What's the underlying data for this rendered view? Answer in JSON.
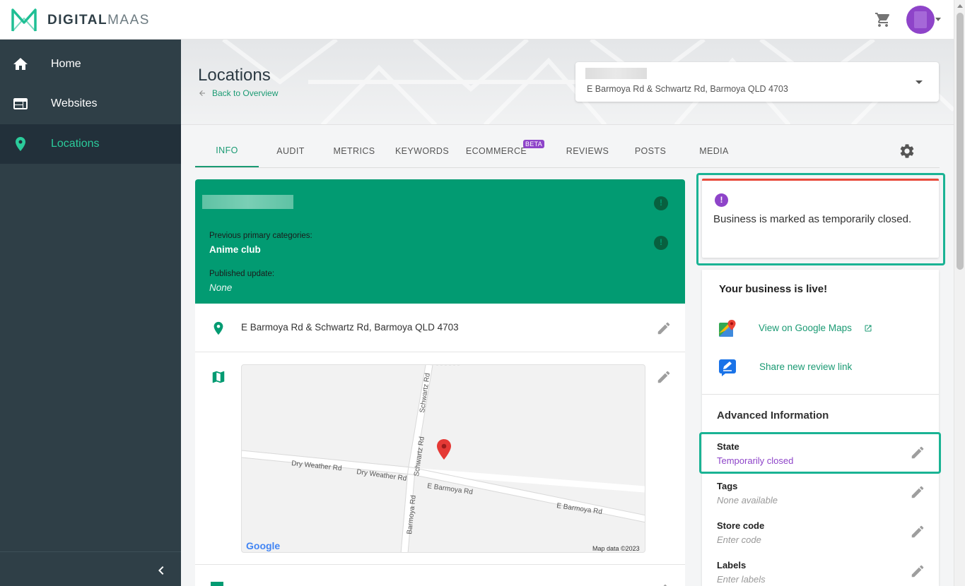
{
  "app": {
    "logo_brand_bold": "DIGITAL",
    "logo_brand_light": "MAAS"
  },
  "colors": {
    "accent_green": "#029b72",
    "link_green": "#1a9a73",
    "sidebar_bg": "#2f3f47",
    "highlight_outline": "#1ab394",
    "alert_red": "#e84b3c",
    "purple": "#8e44c9"
  },
  "sidebar": {
    "items": [
      {
        "label": "Home",
        "icon": "home-icon"
      },
      {
        "label": "Websites",
        "icon": "browser-icon"
      },
      {
        "label": "Locations",
        "icon": "location-pin-icon",
        "active": true
      }
    ]
  },
  "header": {
    "title": "Locations",
    "back_label": "Back to Overview",
    "location_address": "E Barmoya Rd & Schwartz Rd, Barmoya QLD 4703"
  },
  "tabs": [
    {
      "label": "INFO",
      "active": true
    },
    {
      "label": "AUDIT"
    },
    {
      "label": "METRICS"
    },
    {
      "label": "KEYWORDS"
    },
    {
      "label": "ECOMMERCE",
      "badge": "BETA"
    },
    {
      "label": "REVIEWS"
    },
    {
      "label": "POSTS"
    },
    {
      "label": "MEDIA"
    }
  ],
  "green_card": {
    "prev_categories_label": "Previous primary categories:",
    "prev_categories_value": "Anime club",
    "published_label": "Published update:",
    "published_value": "None"
  },
  "info": {
    "address": "E Barmoya Rd & Schwartz Rd, Barmoya QLD 4703",
    "map": {
      "streets": [
        "Dry Weather Rd",
        "Dry Weather Rd",
        "E Barmoya Rd",
        "E Barmoya Rd",
        "Schwartz Rd",
        "Schwartz Rd",
        "Barmoya Rd"
      ],
      "google_logo": "Google",
      "attribution": "Map data ©2023"
    }
  },
  "alert": {
    "text": "Business is marked as temporarily closed."
  },
  "live_card": {
    "title": "Your business is live!",
    "maps_link": "View on Google Maps",
    "review_link": "Share new review link"
  },
  "advanced": {
    "title": "Advanced Information",
    "fields": [
      {
        "label": "State",
        "value": "Temporarily closed"
      },
      {
        "label": "Tags",
        "value": "None available"
      },
      {
        "label": "Store code",
        "value": "Enter code"
      },
      {
        "label": "Labels",
        "value": "Enter labels"
      }
    ]
  }
}
